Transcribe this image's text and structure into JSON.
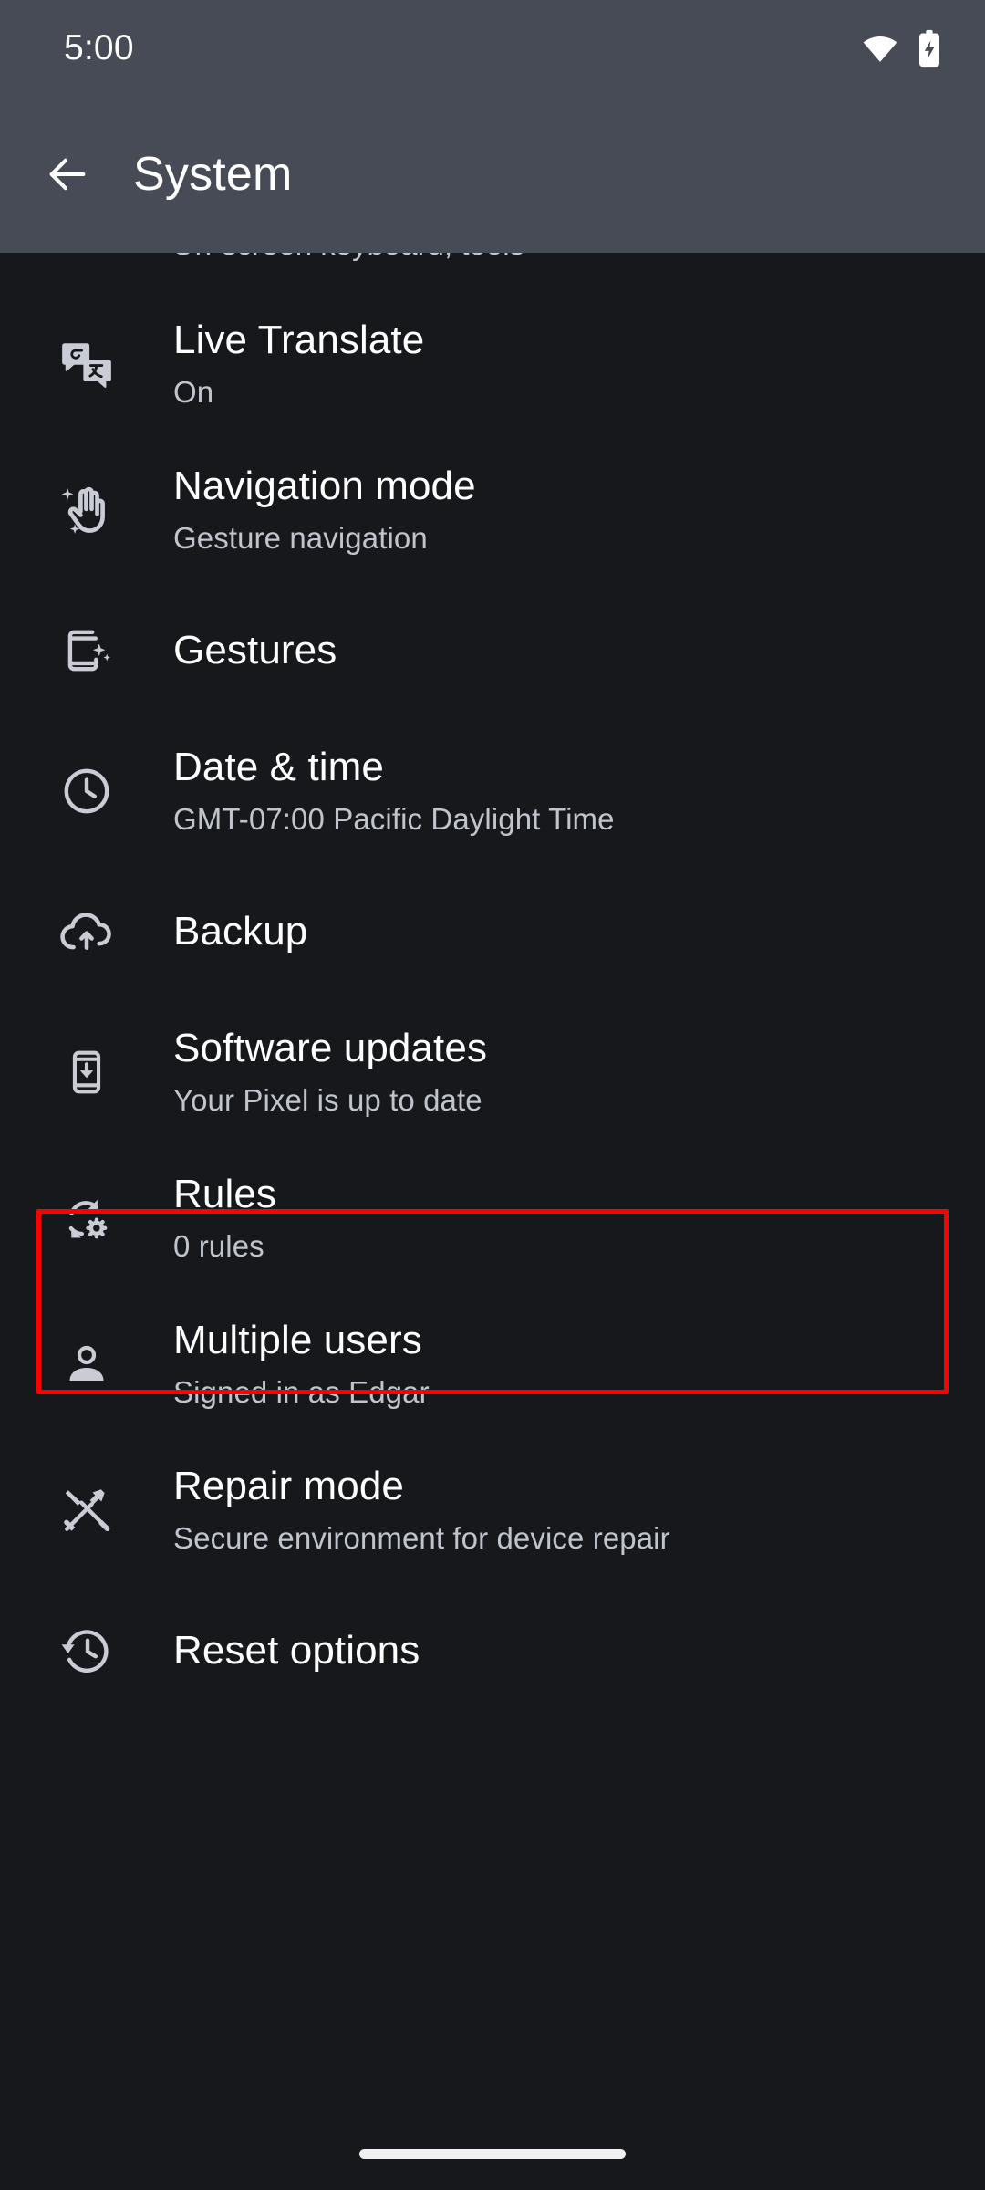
{
  "status_bar": {
    "time": "5:00",
    "icons": [
      "wifi-icon",
      "battery-charging-icon"
    ]
  },
  "app_bar": {
    "back_icon": "back-arrow-icon",
    "title": "System"
  },
  "clipped_previous_row": {
    "summary": "On-screen keyboard, tools"
  },
  "highlight": {
    "color": "#ff0000",
    "target": "Software updates"
  },
  "colors": {
    "app_bar_bg": "#474b55",
    "page_bg": "#16181c",
    "title_text": "#ffffff",
    "summary_text": "#c0c4cc",
    "icon": "#c9ccd4",
    "highlight": "#ff0000"
  },
  "list": {
    "items": [
      {
        "icon": "translate-icon",
        "title": "Live Translate",
        "subtitle": "On"
      },
      {
        "icon": "hand-gesture-icon",
        "title": "Navigation mode",
        "subtitle": "Gesture navigation"
      },
      {
        "icon": "phone-swipe-icon",
        "title": "Gestures",
        "subtitle": ""
      },
      {
        "icon": "clock-icon",
        "title": "Date & time",
        "subtitle": "GMT-07:00 Pacific Daylight Time"
      },
      {
        "icon": "cloud-upload-icon",
        "title": "Backup",
        "subtitle": ""
      },
      {
        "icon": "phone-download-icon",
        "title": "Software updates",
        "subtitle": "Your Pixel is up to date"
      },
      {
        "icon": "rotate-gear-icon",
        "title": "Rules",
        "subtitle": "0 rules"
      },
      {
        "icon": "person-icon",
        "title": "Multiple users",
        "subtitle": "Signed in as Edgar"
      },
      {
        "icon": "tools-icon",
        "title": "Repair mode",
        "subtitle": "Secure environment for device repair"
      },
      {
        "icon": "history-restore-icon",
        "title": "Reset options",
        "subtitle": ""
      }
    ]
  },
  "navigation_bar": {
    "home_indicator": "home-gesture-bar"
  }
}
